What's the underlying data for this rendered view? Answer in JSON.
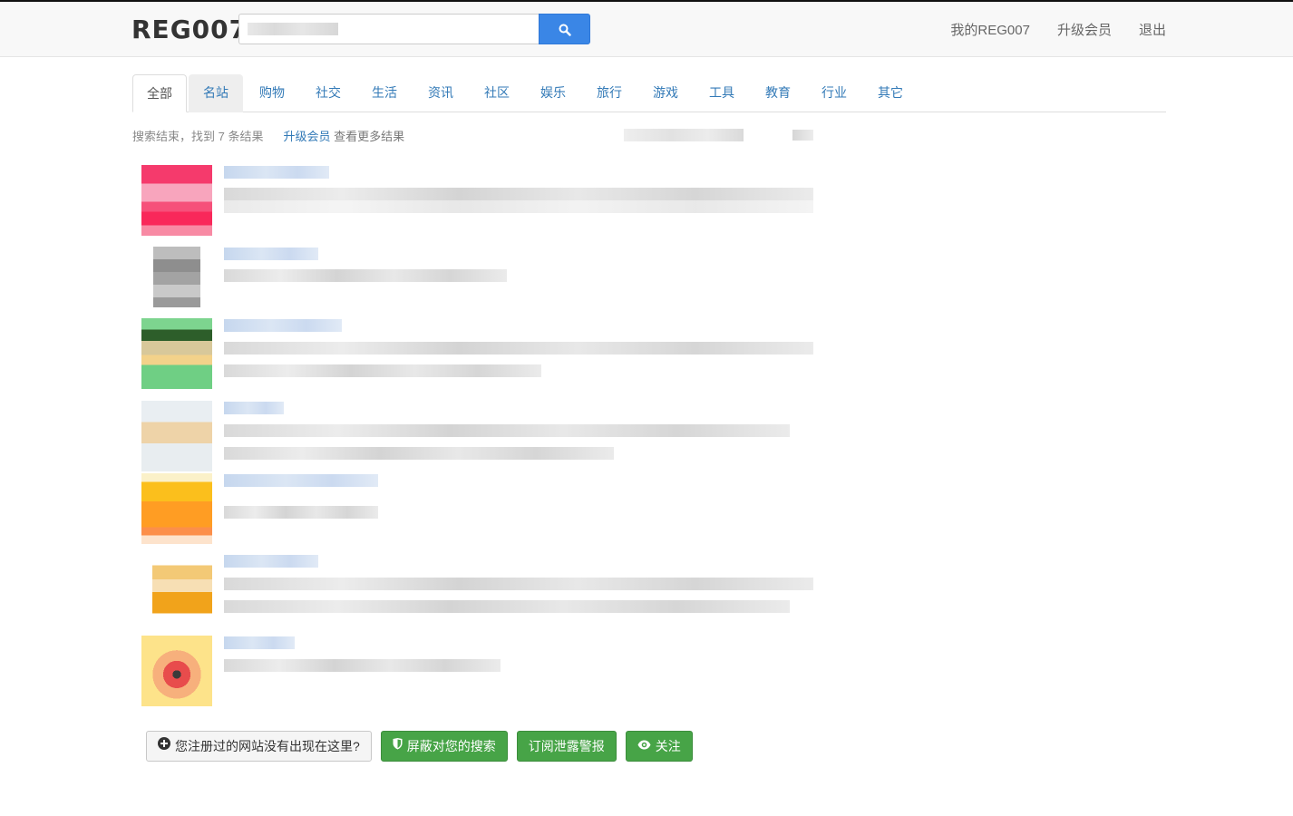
{
  "header": {
    "logo": "REG007",
    "search": {
      "value": "",
      "placeholder": ""
    },
    "nav": [
      {
        "label": "我的REG007"
      },
      {
        "label": "升级会员"
      },
      {
        "label": "退出"
      }
    ]
  },
  "tabs": [
    {
      "label": "全部",
      "state": "active"
    },
    {
      "label": "名站",
      "state": "hover"
    },
    {
      "label": "购物"
    },
    {
      "label": "社交"
    },
    {
      "label": "生活"
    },
    {
      "label": "资讯"
    },
    {
      "label": "社区"
    },
    {
      "label": "娱乐"
    },
    {
      "label": "旅行"
    },
    {
      "label": "游戏"
    },
    {
      "label": "工具"
    },
    {
      "label": "教育"
    },
    {
      "label": "行业"
    },
    {
      "label": "其它"
    }
  ],
  "status": {
    "text": "搜索结束，找到 7 条结果",
    "upgrade_link": "升级会员",
    "more_text": "查看更多结果"
  },
  "results_count": 7,
  "actions": {
    "not_listed": "您注册过的网站没有出现在这里?",
    "block_search": "屏蔽对您的搜索",
    "subscribe_alert": "订阅泄露警报",
    "follow": "关注"
  },
  "colors": {
    "primary_blue": "#3a86e6",
    "link_blue": "#337ab7",
    "success_green": "#47a447"
  }
}
